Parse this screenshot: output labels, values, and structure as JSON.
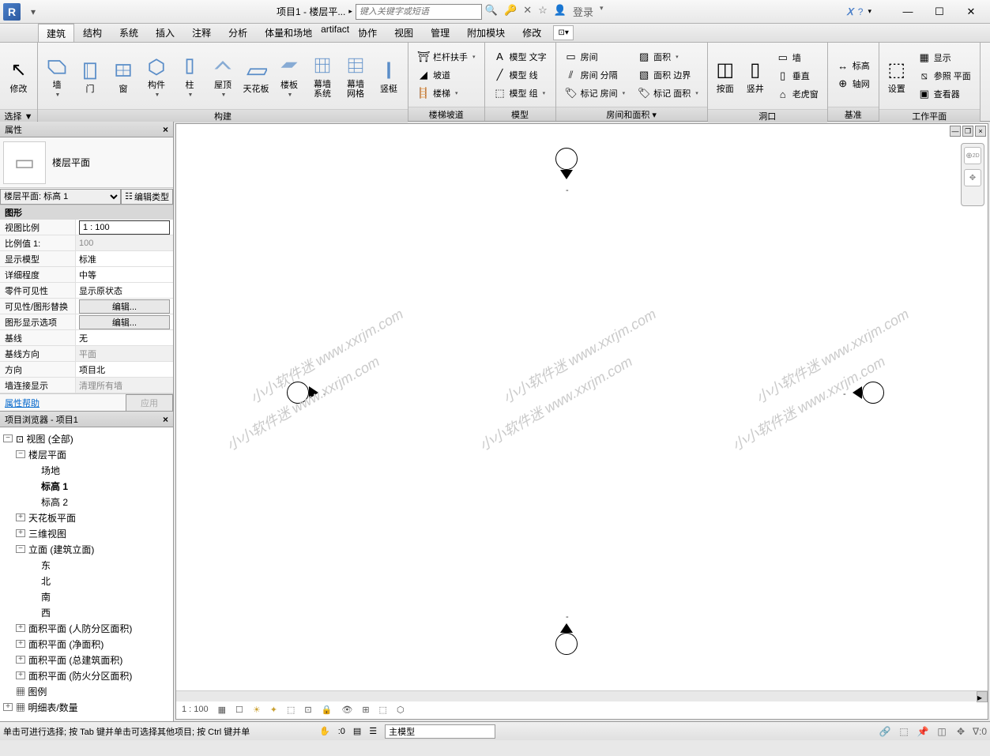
{
  "title": "项目1 - 楼层平...",
  "search_placeholder": "键入关键字或短语",
  "login_label": "登录",
  "menus": [
    "建筑",
    "结构",
    "系统",
    "插入",
    "注释",
    "分析",
    "体量和场地",
    "协作",
    "视图",
    "管理",
    "附加模块",
    "修改"
  ],
  "active_menu": "建筑",
  "ribbon": {
    "select": {
      "modify": "修改",
      "select_label": "选择 ▼"
    },
    "build": {
      "label": "构建",
      "wall": "墙",
      "door": "门",
      "window": "窗",
      "component": "构件",
      "column": "柱",
      "roof": "屋顶",
      "ceiling": "天花板",
      "floor": "楼板",
      "curtain_system": "幕墙\n系统",
      "curtain_grid": "幕墙\n网格",
      "mullion": "竖梃"
    },
    "circ": {
      "label": "楼梯坡道",
      "railing": "栏杆扶手",
      "ramp": "坡道",
      "stair": "楼梯"
    },
    "model": {
      "label": "模型",
      "text": "模型 文字",
      "line": "模型 线",
      "group": "模型 组"
    },
    "room_area": {
      "label": "房间和面积 ▾",
      "room": "房间",
      "sep": "房间 分隔",
      "tag_room": "标记 房间",
      "area": "面积",
      "area_bound": "面积 边界",
      "tag_area": "标记 面积"
    },
    "opening": {
      "label": "洞口",
      "face": "按面",
      "shaft": "竖井",
      "wall": "墙",
      "vertical": "垂直",
      "dormer": "老虎窗"
    },
    "datum": {
      "label": "基准",
      "level": "标高",
      "grid": "轴网"
    },
    "work": {
      "label": "工作平面",
      "set": "设置",
      "show": "显示",
      "ref": "参照 平面",
      "viewer": "查看器"
    }
  },
  "properties": {
    "title": "属性",
    "type_name": "楼层平面",
    "instance_filter": "楼层平面: 标高 1",
    "edit_type": "编辑类型",
    "section": "图形",
    "rows": [
      {
        "k": "视图比例",
        "v": "1 : 100",
        "input": true
      },
      {
        "k": "比例值 1:",
        "v": "100",
        "disabled": true
      },
      {
        "k": "显示模型",
        "v": "标准"
      },
      {
        "k": "详细程度",
        "v": "中等"
      },
      {
        "k": "零件可见性",
        "v": "显示原状态"
      },
      {
        "k": "可见性/图形替换",
        "v": "编辑...",
        "btn": true
      },
      {
        "k": "图形显示选项",
        "v": "编辑...",
        "btn": true
      },
      {
        "k": "基线",
        "v": "无"
      },
      {
        "k": "基线方向",
        "v": "平面",
        "disabled": true
      },
      {
        "k": "方向",
        "v": "项目北"
      },
      {
        "k": "墙连接显示",
        "v": "清理所有墙",
        "disabled": true
      }
    ],
    "help": "属性帮助",
    "apply": "应用"
  },
  "browser": {
    "title": "项目浏览器 - 项目1",
    "root": "视图 (全部)",
    "floor_plans": "楼层平面",
    "fp_items": [
      "场地",
      "标高 1",
      "标高 2"
    ],
    "ceiling_plans": "天花板平面",
    "_3d": "三维视图",
    "elevations": "立面 (建筑立面)",
    "elev_items": [
      "东",
      "北",
      "南",
      "西"
    ],
    "area1": "面积平面 (人防分区面积)",
    "area2": "面积平面 (净面积)",
    "area3": "面积平面 (总建筑面积)",
    "area4": "面积平面 (防火分区面积)",
    "legends": "图例",
    "schedules": "明细表/数量"
  },
  "view_scale": "1 : 100",
  "status_hint": "单击可进行选择; 按 Tab 键并单击可选择其他项目; 按 Ctrl 键并单",
  "status_sel": ":0",
  "status_model": "主模型",
  "watermark": "小小软件迷 www.xxrjm.com"
}
